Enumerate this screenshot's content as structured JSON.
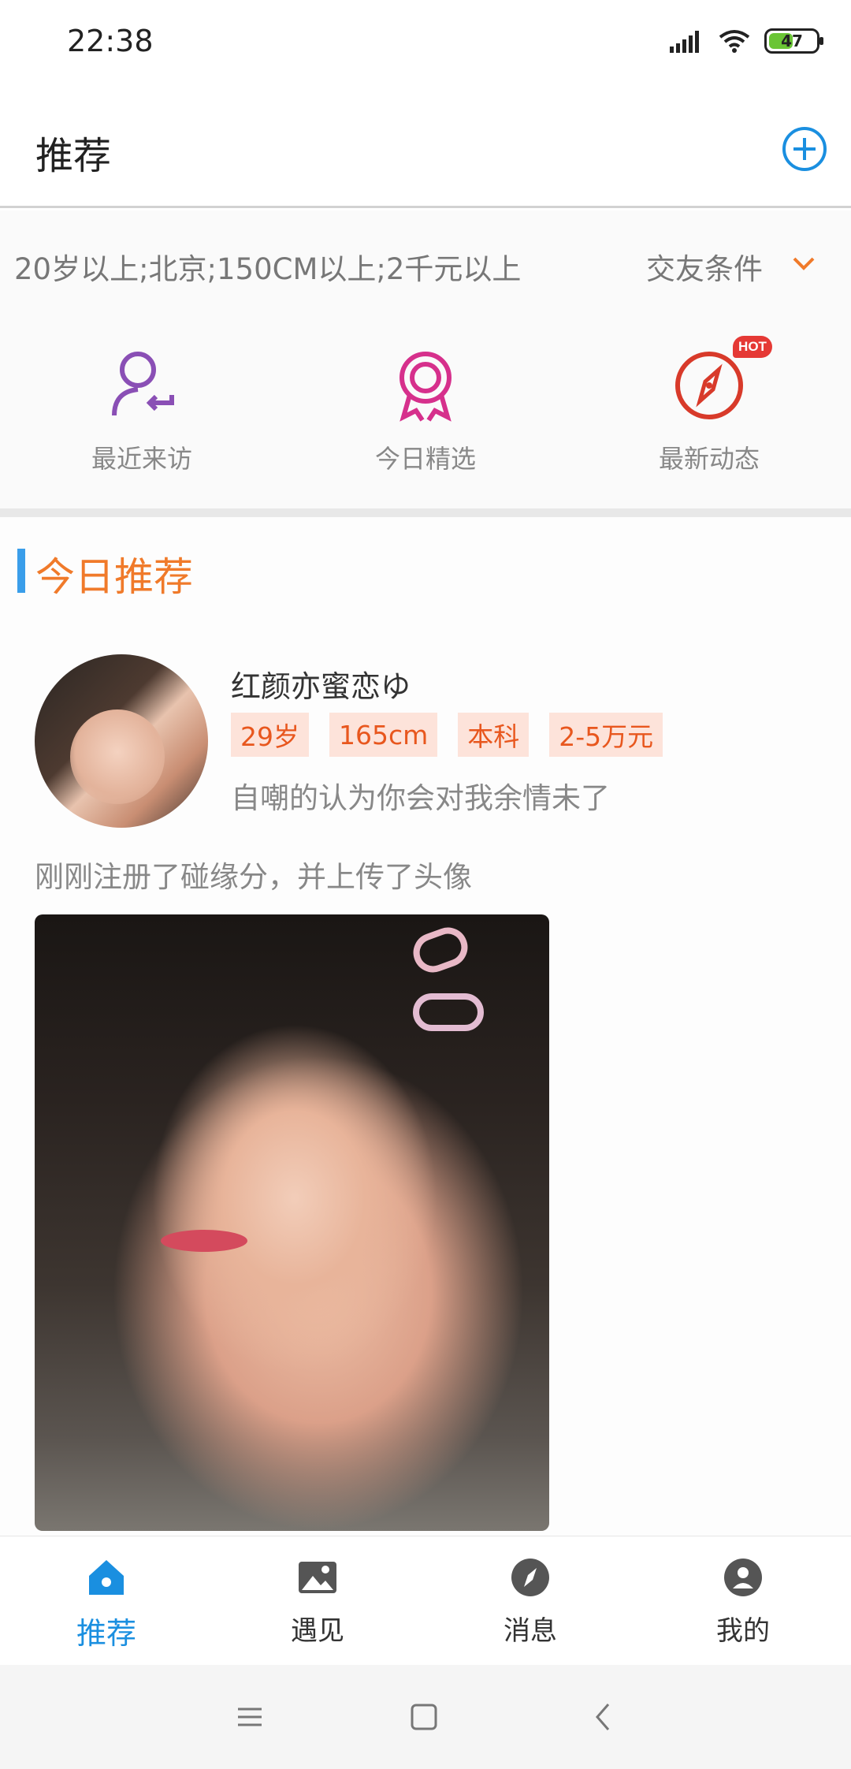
{
  "status_bar": {
    "time": "22:38",
    "battery": "47"
  },
  "header": {
    "title": "推荐"
  },
  "filter": {
    "summary": "20岁以上;北京;150CM以上;2千元以上",
    "label": "交友条件"
  },
  "quick_actions": [
    {
      "label": "最近来访",
      "icon": "recent-visitor-icon",
      "color": "#8a4fb5"
    },
    {
      "label": "今日精选",
      "icon": "award-ribbon-icon",
      "color": "#d6308c"
    },
    {
      "label": "最新动态",
      "icon": "compass-icon",
      "color": "#d83a2a",
      "badge": "HOT"
    }
  ],
  "section": {
    "title": "今日推荐"
  },
  "profile": {
    "name": "红颜亦蜜恋ゆ",
    "tags": [
      "29岁",
      "165cm",
      "本科",
      "2-5万元"
    ],
    "bio": "自嘲的认为你会对我余情未了",
    "activity": "刚刚注册了碰缘分，并上传了头像"
  },
  "tabs": [
    {
      "label": "推荐",
      "icon": "home-icon",
      "active": true
    },
    {
      "label": "遇见",
      "icon": "image-icon",
      "active": false
    },
    {
      "label": "消息",
      "icon": "compass-circle-icon",
      "active": false
    },
    {
      "label": "我的",
      "icon": "user-circle-icon",
      "active": false
    }
  ],
  "colors": {
    "accent_blue": "#1a8fe0",
    "accent_orange": "#f07a2a",
    "tag_bg": "#fde3da",
    "tag_text": "#e8571e"
  }
}
